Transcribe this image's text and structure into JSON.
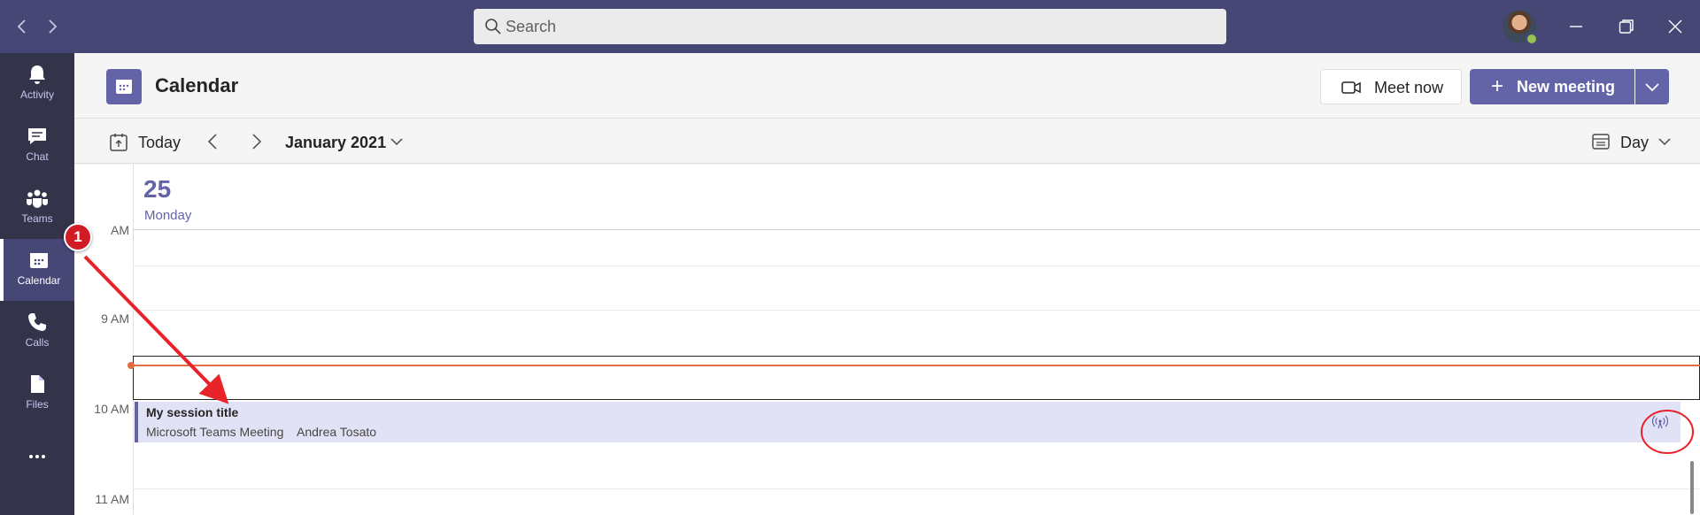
{
  "titlebar": {
    "search_placeholder": "Search",
    "back_icon": "chevron-left-icon",
    "forward_icon": "chevron-right-icon",
    "minimize_icon": "minimize-icon",
    "restore_icon": "restore-icon",
    "close_icon": "close-icon"
  },
  "rail": {
    "items": [
      {
        "label": "Activity",
        "icon": "bell-icon"
      },
      {
        "label": "Chat",
        "icon": "chat-icon"
      },
      {
        "label": "Teams",
        "icon": "teams-icon"
      },
      {
        "label": "Calendar",
        "icon": "calendar-icon",
        "active": true
      },
      {
        "label": "Calls",
        "icon": "phone-icon"
      },
      {
        "label": "Files",
        "icon": "files-icon"
      }
    ],
    "more_label": "..."
  },
  "header": {
    "title": "Calendar",
    "meet_now_label": "Meet now",
    "new_meeting_label": "New meeting"
  },
  "toolbar": {
    "today_label": "Today",
    "month_label": "January 2021",
    "view_label": "Day"
  },
  "day": {
    "number": "25",
    "name": "Monday"
  },
  "times": {
    "am_partial": "AM",
    "t9": "9 AM",
    "t10": "10 AM",
    "t11": "11 AM"
  },
  "event": {
    "title": "My session title",
    "meeting_type": "Microsoft Teams Meeting",
    "organizer": "Andrea Tosato",
    "icon": "broadcast-icon"
  },
  "annotation": {
    "badge_number": "1"
  },
  "colors": {
    "titlebar": "#464775",
    "rail": "#33344a",
    "brand": "#6264a7",
    "event_bg": "#e2e2f6",
    "now_line": "#e36d3f",
    "annotation_red": "#d01c24"
  }
}
